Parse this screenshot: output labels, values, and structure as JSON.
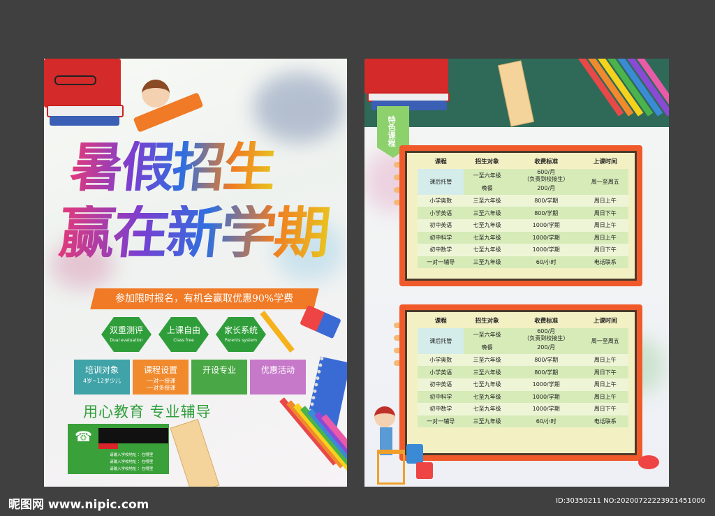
{
  "left_flyer": {
    "title_line1": "暑假招生",
    "title_line2": "赢在新学期",
    "slogan": "参加限时报名，有机会赢取优惠90%学费",
    "features": [
      {
        "title": "双重测评",
        "subtitle": "Dual evaluation"
      },
      {
        "title": "上课自由",
        "subtitle": "Class free"
      },
      {
        "title": "家长系统",
        "subtitle": "Parents system"
      }
    ],
    "boxes": [
      {
        "title": "培训对象",
        "subtitle": "4岁~12岁少儿",
        "color": "#3fa3a8"
      },
      {
        "title": "课程设置",
        "subtitle": "·一对一授课\n·一对多授课",
        "color": "#f08a2d"
      },
      {
        "title": "开设专业",
        "subtitle": "",
        "color": "#49a845"
      },
      {
        "title": "优惠活动",
        "subtitle": "",
        "color": "#c779c9"
      }
    ],
    "motto": "用心教育  专业辅导",
    "address_lines": [
      "请输入学校地址  ：在哪里",
      "请输入学校地址  ：在哪里",
      "请输入学校地址  ：在哪里"
    ]
  },
  "right_flyer": {
    "tag": "特色课程",
    "table": {
      "headers": [
        "课程",
        "招生对象",
        "收费标准",
        "上课时间"
      ],
      "first_row": {
        "course": "课后托管",
        "target_top": "一至六年级",
        "target_bottom": "晚餐",
        "fee_line1": "600/月",
        "fee_line2": "（负责到校接生）",
        "fee_line3": "200/月",
        "time": "周一至周五"
      },
      "rows": [
        [
          "小学奥数",
          "三至六年级",
          "800/学期",
          "周日上午"
        ],
        [
          "小学英语",
          "三至六年级",
          "800/学期",
          "周日下午"
        ],
        [
          "初中英语",
          "七至九年级",
          "1000/学期",
          "周日上午"
        ],
        [
          "初中科学",
          "七至九年级",
          "1000/学期",
          "周日上午"
        ],
        [
          "初中数学",
          "七至九年级",
          "1000/学期",
          "周日下午"
        ],
        [
          "一对一辅导",
          "三至九年级",
          "60/小时",
          "电话联系"
        ]
      ]
    }
  },
  "watermark": {
    "logo": "昵图网 www.nipic.com",
    "id": "ID:30350211 NO:20200722223921451000"
  }
}
